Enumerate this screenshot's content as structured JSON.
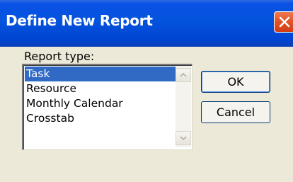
{
  "window": {
    "title": "Define New Report"
  },
  "form": {
    "report_type_label": "Report type:",
    "report_types": [
      "Task",
      "Resource",
      "Monthly Calendar",
      "Crosstab"
    ],
    "selected_index": 0
  },
  "buttons": {
    "ok_label": "OK",
    "cancel_label": "Cancel"
  },
  "colors": {
    "titlebar": "#0453dd",
    "selection": "#316ac5",
    "close_button": "#e3552b",
    "dialog_face": "#ece9d8"
  },
  "icons": {
    "close": "close-icon",
    "scroll_up": "chevron-up-icon",
    "scroll_down": "chevron-down-icon"
  }
}
